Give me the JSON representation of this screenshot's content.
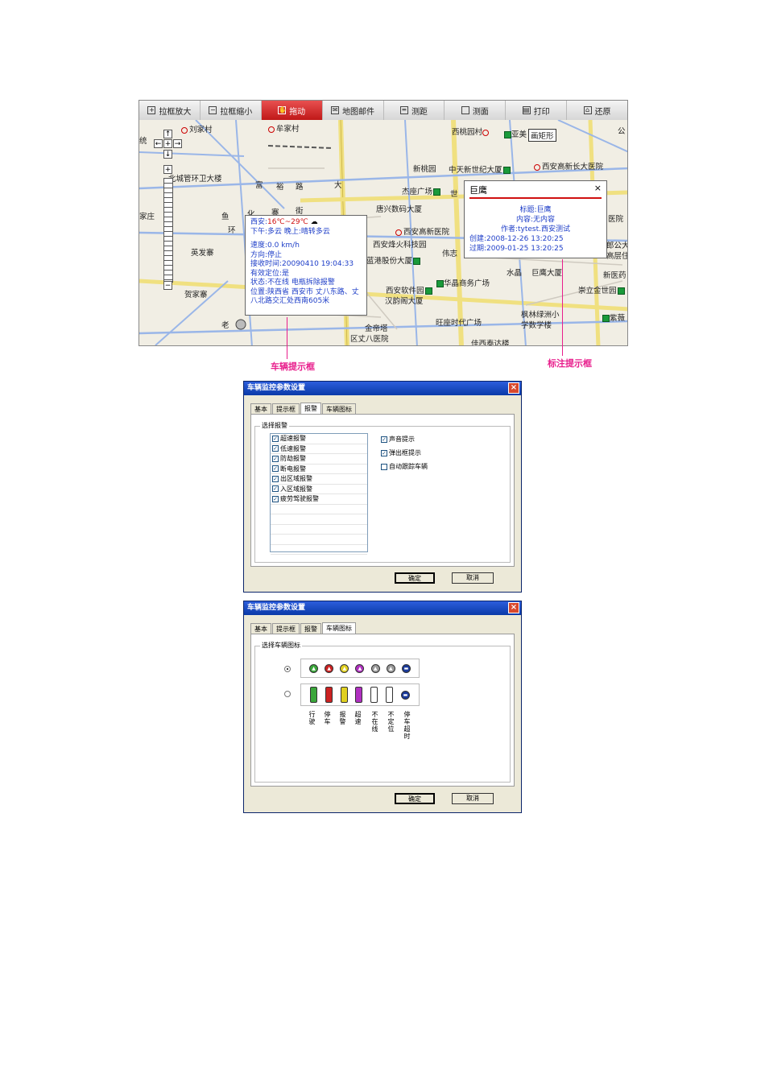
{
  "map": {
    "toolbar": [
      {
        "label": "拉框放大",
        "icon": "zoom-in-box-icon"
      },
      {
        "label": "拉框缩小",
        "icon": "zoom-out-box-icon"
      },
      {
        "label": "拖动",
        "icon": "pan-hand-icon",
        "active": true
      },
      {
        "label": "地图邮件",
        "icon": "map-mail-icon"
      },
      {
        "label": "测距",
        "icon": "measure-distance-icon"
      },
      {
        "label": "测面",
        "icon": "measure-area-icon"
      },
      {
        "label": "打印",
        "icon": "print-icon"
      },
      {
        "label": "还原",
        "icon": "restore-icon"
      }
    ],
    "labels": {
      "l1": "刘家村",
      "l2": "牟家村",
      "l3": "西桃园村",
      "l4": "亚美",
      "l5": "画矩形",
      "l6": "公",
      "l7": "新桃园",
      "l8": "中天新世纪大厦",
      "l9": "西安高新长大医院",
      "l10": "北城管环卫大楼",
      "l11": "富",
      "l12": "裕",
      "l13": "路",
      "l14": "大",
      "l15": "杰座广场",
      "l16": "世",
      "l17": "鱼",
      "l18": "化",
      "l19": "寨",
      "l20": "街",
      "l21": "唐兴数码大厦",
      "l22": "西安高新医院",
      "l23": "西安烽火科技园",
      "l24": "伟志",
      "l25": "蓝港股份大厦",
      "l26": "水晶",
      "l27": "巨鹰大厦",
      "l28": "新医药",
      "l29": "西安软件园",
      "l30": "华晶商务广场",
      "l31": "汉韵阁大厦",
      "l32": "崇立金世园",
      "l33": "英发寨",
      "l34": "贺家寨",
      "l35": "老",
      "l36": "旺座时代广场",
      "l37": "枫林绿洲小",
      "l38": "学数学楼",
      "l39": "紫薇",
      "l40": "金帝塔",
      "l41": "区丈八医院",
      "l42": "佳西泰达楼",
      "l43": "环",
      "l44": "家庄",
      "l45": "统",
      "l46": "郎公大",
      "l47": "高层住",
      "l48": "医院"
    },
    "vehicle_popup": {
      "weather_prefix": "西安:",
      "weather_temp": "16℃~29℃",
      "weather_forecast": "下午:多云 晚上:晴转多云",
      "speed": "速度:0.0 km/h",
      "direction": "方向:停止",
      "recv_time": "接收时间:20090410 19:04:33",
      "valid_fix": "有效定位:是",
      "status": "状态:不在线 电瓶拆除报警",
      "location": "位置:陕西省 西安市 丈八东路、丈八北路交汇处西南605米"
    },
    "annot_popup": {
      "title": "巨鹰",
      "close": "×",
      "line1": "标题:巨鹰",
      "line2": "内容:无内容",
      "line3": "作者:tytest.西安测试",
      "created": "创建:2008-12-26 13:20:25",
      "expires": "过期:2009-01-25 13:20:25"
    },
    "callouts": {
      "vehicle": "车辆提示框",
      "annotation": "标注提示框"
    }
  },
  "dialog1": {
    "title": "车辆监控参数设置",
    "close": "×",
    "tabs": [
      "基本",
      "提示框",
      "报警",
      "车辆图标"
    ],
    "active_tab": 2,
    "group_title": "选择报警",
    "alarms": [
      {
        "label": "超速报警",
        "checked": true
      },
      {
        "label": "低速报警",
        "checked": true
      },
      {
        "label": "防劫报警",
        "checked": true
      },
      {
        "label": "断电报警",
        "checked": true
      },
      {
        "label": "出区域报警",
        "checked": true
      },
      {
        "label": "入区域报警",
        "checked": true
      },
      {
        "label": "疲劳驾驶报警",
        "checked": true
      }
    ],
    "options": [
      {
        "label": "声音提示",
        "checked": true
      },
      {
        "label": "弹出框提示",
        "checked": true
      },
      {
        "label": "自动跟踪车辆",
        "checked": false
      }
    ],
    "ok": "确定",
    "cancel": "取消"
  },
  "dialog2": {
    "title": "车辆监控参数设置",
    "close": "×",
    "tabs": [
      "基本",
      "提示框",
      "报警",
      "车辆图标"
    ],
    "active_tab": 3,
    "group_title": "选择车辆图标",
    "icon_colors": [
      "#3aa63a",
      "#cc2222",
      "#e0d020",
      "#b030c0",
      "#9a9a9a",
      "#9a9a9a",
      "#1a3a9a"
    ],
    "round_selected": true,
    "states": [
      "行驶",
      "停车",
      "报警",
      "超速",
      "不在线",
      "不定位",
      "停车超时"
    ],
    "ok": "确定",
    "cancel": "取消"
  }
}
